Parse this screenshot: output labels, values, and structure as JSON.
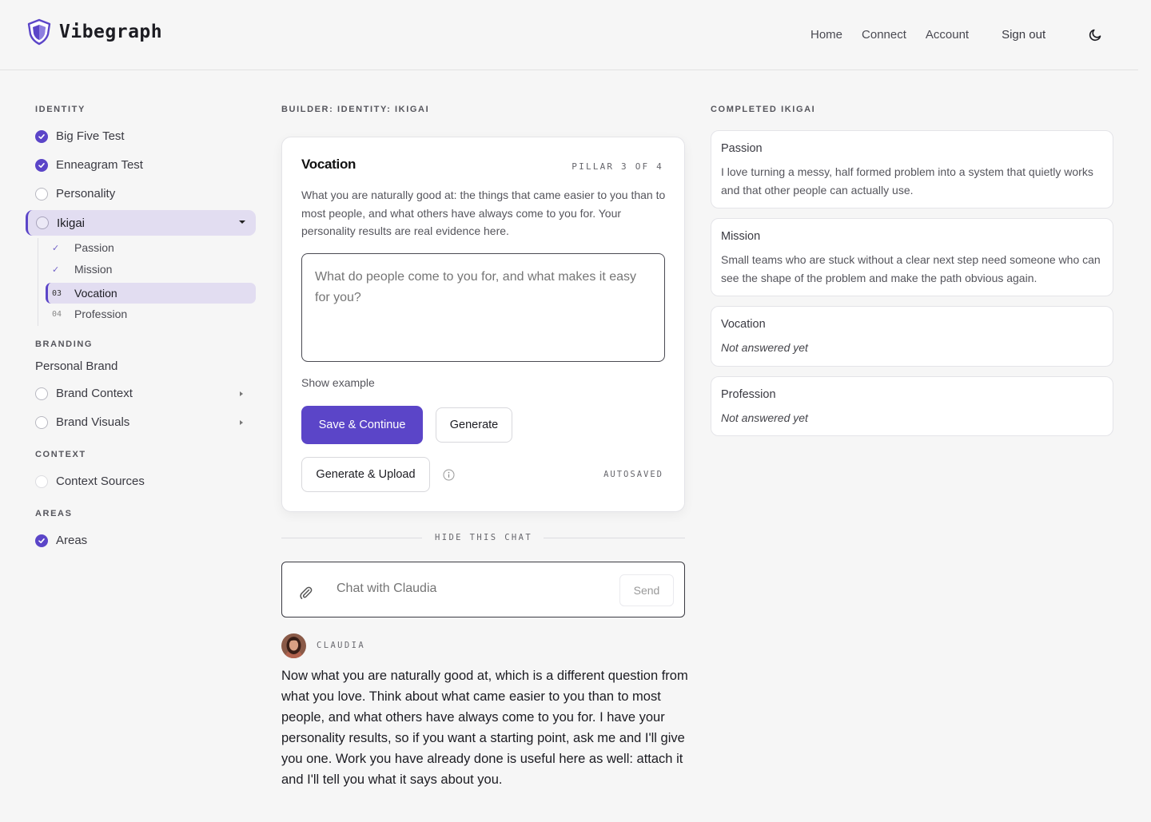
{
  "app": {
    "name": "Vibegraph"
  },
  "nav": {
    "home": "Home",
    "connect": "Connect",
    "account": "Account",
    "sign_out": "Sign out",
    "theme_icon": "moon-icon"
  },
  "sidebar": {
    "identity_label": "IDENTITY",
    "identity_items": [
      {
        "label": "Big Five Test",
        "done": true
      },
      {
        "label": "Enneagram Test",
        "done": true
      },
      {
        "label": "Personality",
        "done": false
      },
      {
        "label": "Ikigai",
        "done": false,
        "expanded": true
      }
    ],
    "ikigai_subitems": [
      {
        "marker": "✓",
        "label": "Passion"
      },
      {
        "marker": "✓",
        "label": "Mission"
      },
      {
        "marker": "03",
        "label": "Vocation",
        "active": true
      },
      {
        "marker": "04",
        "label": "Profession"
      }
    ],
    "branding_label": "BRANDING",
    "personal_brand": "Personal Brand",
    "brand_items": [
      {
        "label": "Brand Context"
      },
      {
        "label": "Brand Visuals"
      }
    ],
    "context_label": "CONTEXT",
    "context_item": "Context Sources",
    "areas_label": "AREAS",
    "areas_item": "Areas"
  },
  "builder": {
    "breadcrumb": "BUILDER: IDENTITY: IKIGAI",
    "title": "Vocation",
    "pillar": "PILLAR 3 OF 4",
    "description": "What you are naturally good at: the things that came easier to you than to most people, and what others have always come to you for. Your personality results are real evidence here.",
    "placeholder": "What do people come to you for, and what makes it easy for you?",
    "show_example": "Show example",
    "save_continue": "Save & Continue",
    "generate": "Generate",
    "generate_upload": "Generate & Upload",
    "autosaved": "AUTOSAVED"
  },
  "chat": {
    "hide": "HIDE THIS CHAT",
    "placeholder": "Chat with Claudia",
    "send": "Send",
    "agent_name": "CLAUDIA",
    "message": "Now what you are naturally good at, which is a different question from what you love. Think about what came easier to you than to most people, and what others have always come to you for. I have your personality results, so if you want a starting point, ask me and I'll give you one. Work you have already done is useful here as well: attach it and I'll tell you what it says about you."
  },
  "completed": {
    "label": "COMPLETED IKIGAI",
    "items": [
      {
        "title": "Passion",
        "text": "I love turning a messy, half formed problem into a system that quietly works and that other people can actually use."
      },
      {
        "title": "Mission",
        "text": "Small teams who are stuck without a clear next step need someone who can see the shape of the problem and make the path obvious again."
      },
      {
        "title": "Vocation",
        "text": "Not answered yet"
      },
      {
        "title": "Profession",
        "text": "Not answered yet"
      }
    ]
  },
  "colors": {
    "accent": "#5b45c8",
    "accent_soft": "#e2ddf1",
    "background": "#f6f6f6"
  }
}
